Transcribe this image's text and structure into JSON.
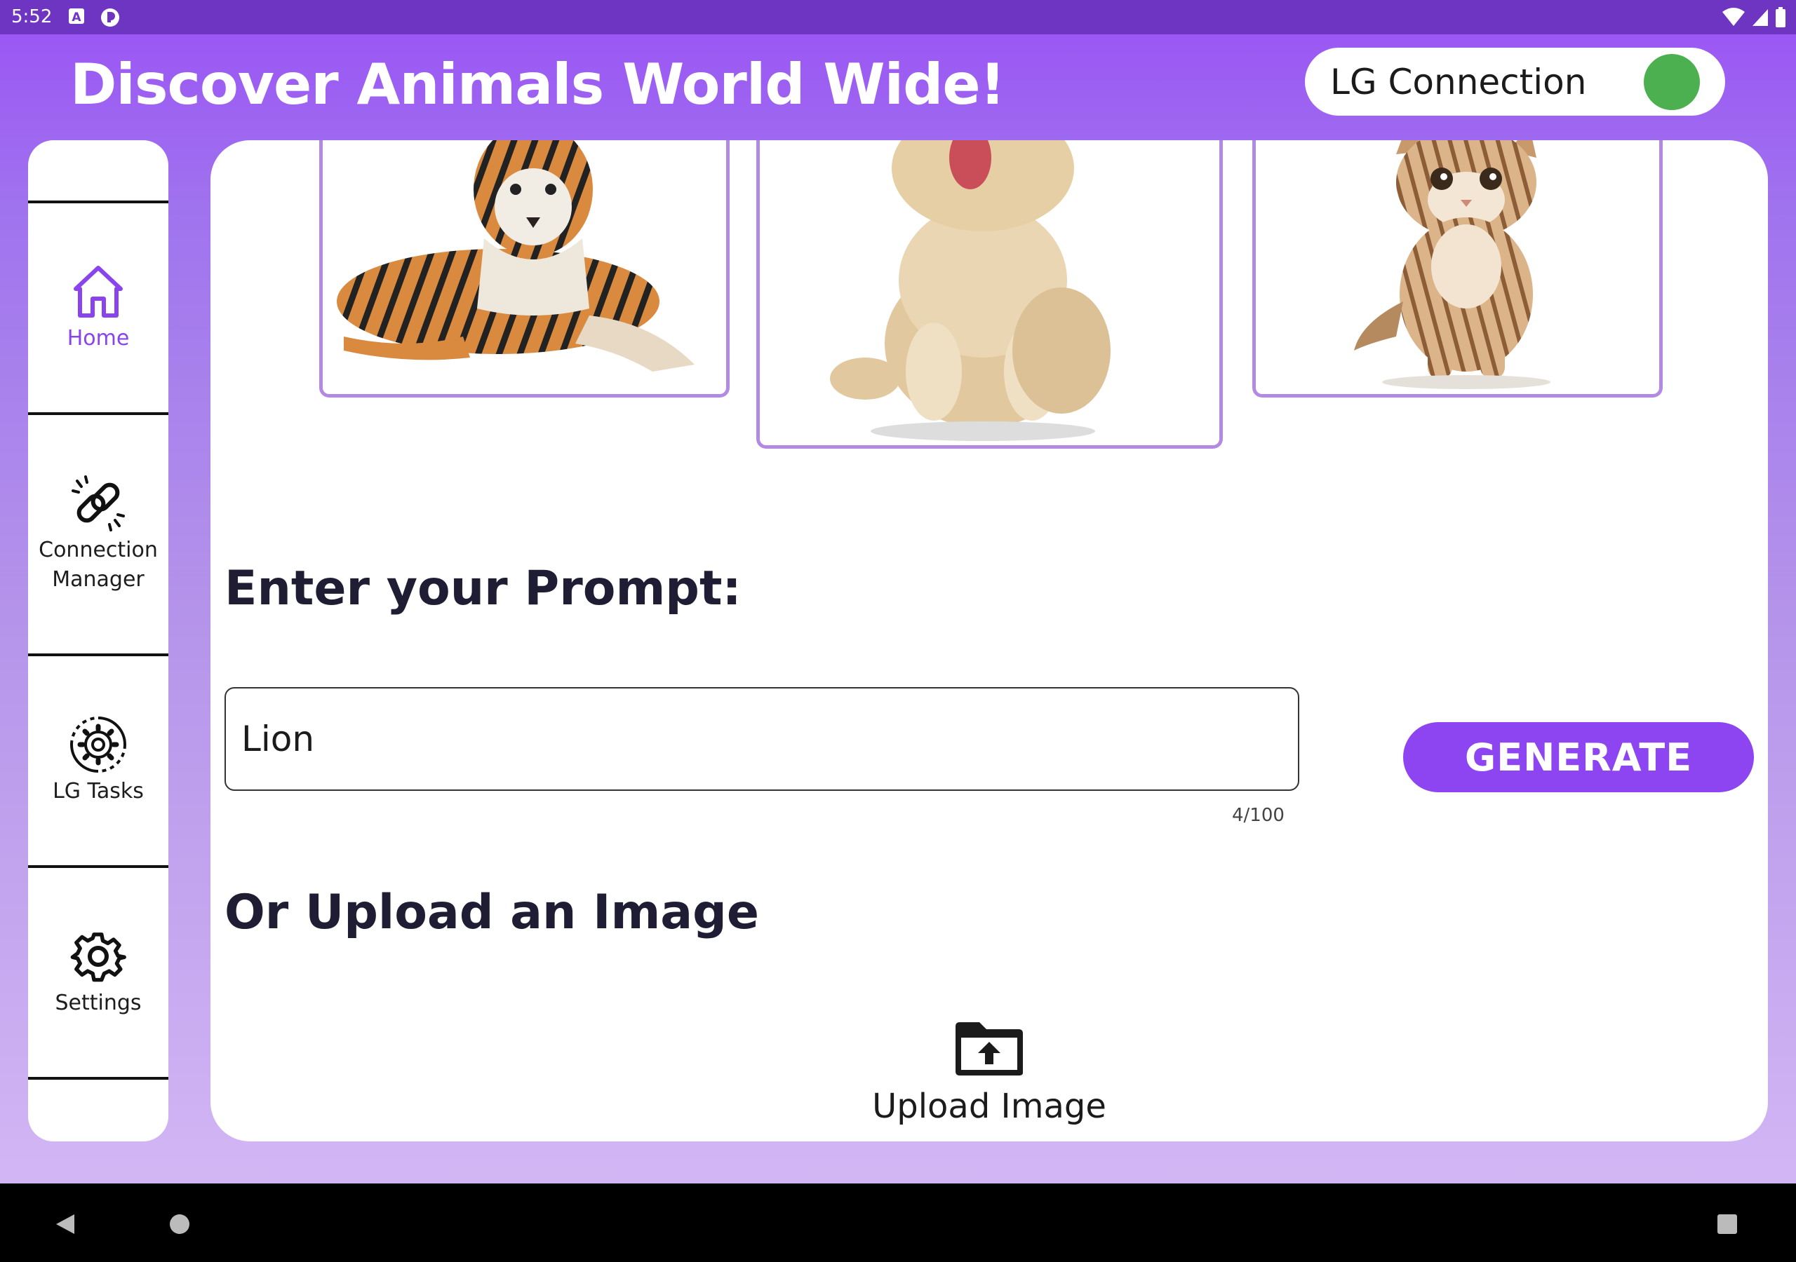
{
  "status_bar": {
    "time": "5:52",
    "icons_left": [
      "accessibility-a-icon",
      "app-notification-icon"
    ],
    "icons_right": [
      "wifi-icon",
      "cell-signal-icon",
      "battery-icon"
    ]
  },
  "header": {
    "title": "Discover Animals World Wide!",
    "lg_connection": {
      "label": "LG Connection",
      "status": "connected",
      "status_color": "#4caf50"
    }
  },
  "sidebar": {
    "items": [
      {
        "label": "Home",
        "icon": "home-icon",
        "active": true
      },
      {
        "label": "Connection\nManager",
        "icon": "link-icon",
        "active": false
      },
      {
        "label": "LG Tasks",
        "icon": "gear-cycle-icon",
        "active": false
      },
      {
        "label": "Settings",
        "icon": "settings-icon",
        "active": false
      }
    ]
  },
  "carousel": {
    "items": [
      {
        "animal": "tiger"
      },
      {
        "animal": "dog"
      },
      {
        "animal": "cat"
      }
    ]
  },
  "prompt": {
    "heading": "Enter your Prompt:",
    "value": "Lion",
    "counter": "4/100",
    "generate_label": "GENERATE"
  },
  "upload": {
    "heading": "Or Upload an Image",
    "label": "Upload Image",
    "icon": "folder-upload-icon"
  },
  "nav_bar": {
    "icons": [
      "back-icon",
      "home-circle-icon",
      "recents-icon"
    ]
  },
  "colors": {
    "accent": "#8c45f0",
    "header_gradient_top": "#9a52f5",
    "card_border": "#b28ae3",
    "status_connected": "#4caf50"
  }
}
